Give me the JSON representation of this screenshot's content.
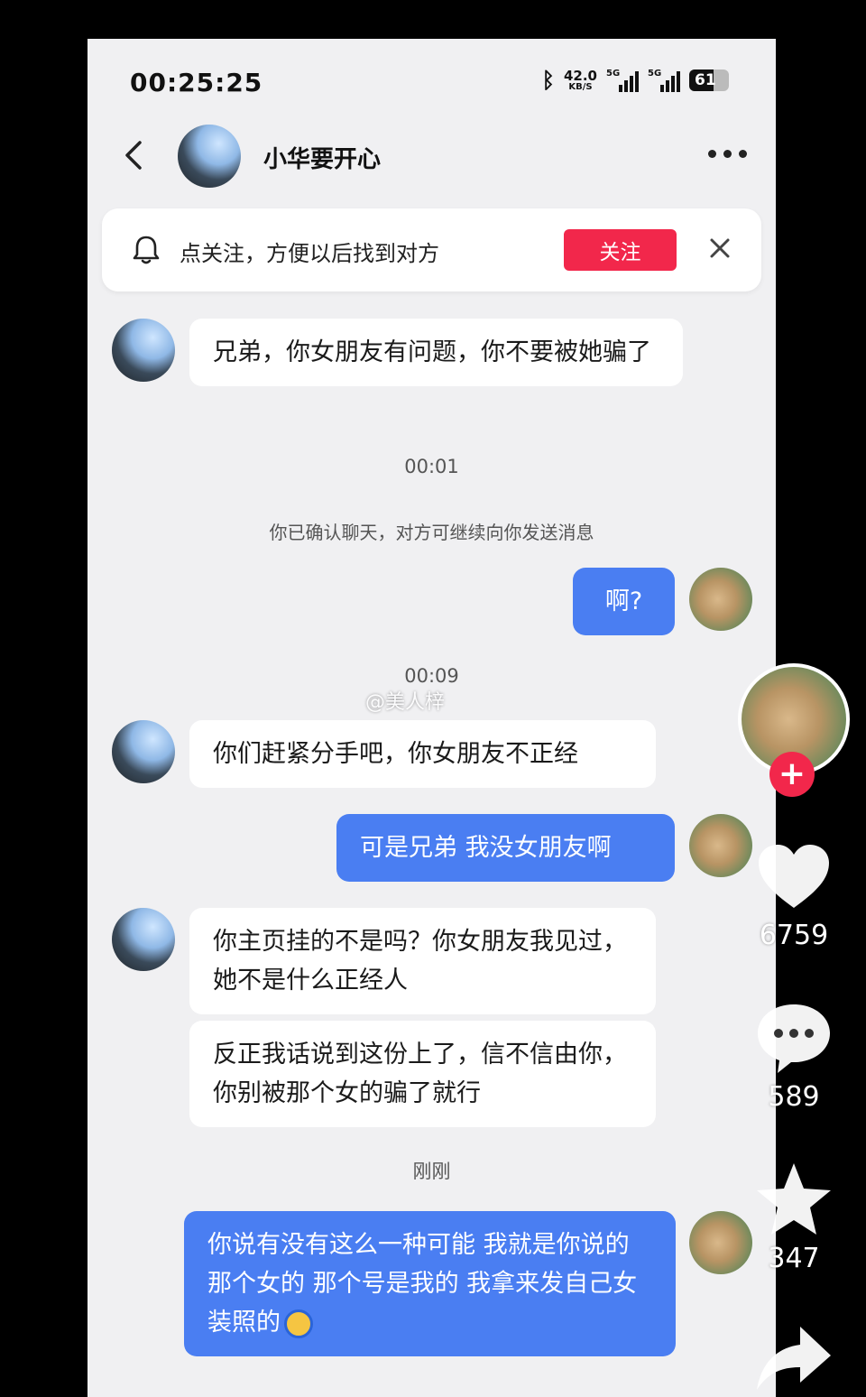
{
  "status_bar": {
    "time": "00:25:25",
    "net_speed": "42.0",
    "net_unit": "KB/S",
    "signal1_label": "5G",
    "signal2_label": "5G",
    "battery": "61"
  },
  "header": {
    "title": "小华要开心"
  },
  "follow_banner": {
    "text": "点关注，方便以后找到对方",
    "button": "关注"
  },
  "messages": [
    {
      "text": "兄弟，你女朋友有问题，你不要被她骗了"
    },
    {
      "text": "啊?"
    },
    {
      "text": "你们赶紧分手吧，你女朋友不正经"
    },
    {
      "text": "可是兄弟  我没女朋友啊"
    },
    {
      "text": "你主页挂的不是吗？你女朋友我见过，她不是什么正经人"
    },
    {
      "text": "反正我话说到这份上了，信不信由你，你别被那个女的骗了就行"
    },
    {
      "text": "你说有没有这么一种可能  我就是你说的那个女的  那个号是我的  我拿来发自己女装照的"
    }
  ],
  "timestamps": [
    "00:01",
    "00:09",
    "刚刚"
  ],
  "system_note": "你已确认聊天，对方可继续向你发送消息",
  "watermark": "@美人梓",
  "side_rail": {
    "likes": "6759",
    "comments": "589",
    "favorites": "347"
  },
  "colors": {
    "accent_red": "#f2274b",
    "bubble_blue": "#4a7ef2",
    "chat_bg": "#f0f0f2"
  }
}
